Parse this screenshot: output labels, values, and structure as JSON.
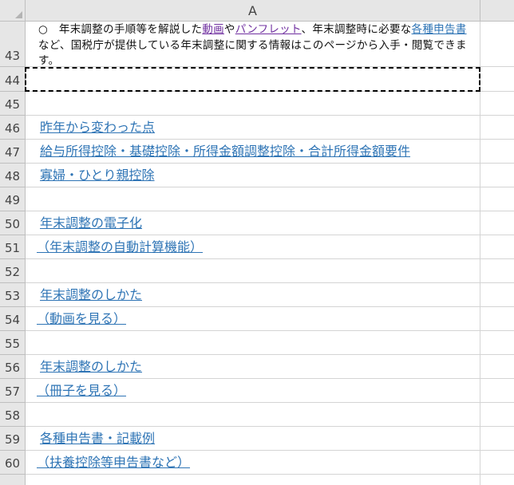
{
  "column_header": {
    "a": "A"
  },
  "row43": {
    "num": "43",
    "bullet": "○",
    "text1": "年末調整の手順等を解説した",
    "link_video": "動画",
    "text2": "や",
    "link_pamphlet": "パンフレット",
    "text3": "、年末調整時に必要な",
    "link_forms": "各種申告書",
    "text4": "など、国税庁が提供している年末調整に関する情報はこのページから入手・閲覧できます。"
  },
  "rows": [
    {
      "num": "44",
      "text": ""
    },
    {
      "num": "45",
      "text": ""
    },
    {
      "num": "46",
      "text": "昨年から変わった点"
    },
    {
      "num": "47",
      "text": "給与所得控除・基礎控除・所得金額調整控除・合計所得金額要件"
    },
    {
      "num": "48",
      "text": "寡婦・ひとり親控除"
    },
    {
      "num": "49",
      "text": ""
    },
    {
      "num": "50",
      "text": "年末調整の電子化"
    },
    {
      "num": "51",
      "text": "（年末調整の自動計算機能）"
    },
    {
      "num": "52",
      "text": ""
    },
    {
      "num": "53",
      "text": "年末調整のしかた"
    },
    {
      "num": "54",
      "text": "（動画を見る）"
    },
    {
      "num": "55",
      "text": ""
    },
    {
      "num": "56",
      "text": "年末調整のしかた"
    },
    {
      "num": "57",
      "text": "（冊子を見る）"
    },
    {
      "num": "58",
      "text": ""
    },
    {
      "num": "59",
      "text": "各種申告書・記載例"
    },
    {
      "num": "60",
      "text": "（扶養控除等申告書など）"
    }
  ],
  "colors": {
    "link": "#2e74b5",
    "visited_link": "#7030a0",
    "header_bg": "#e6e6e6"
  }
}
